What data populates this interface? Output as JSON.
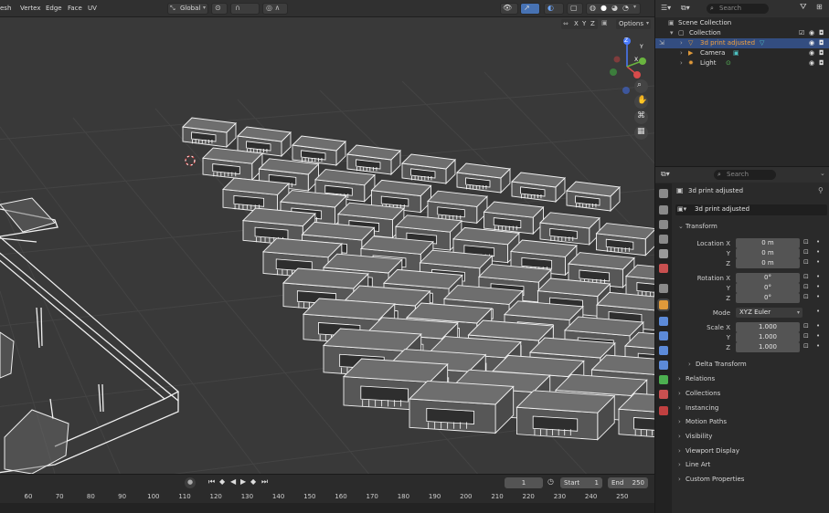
{
  "viewport_header": {
    "menus": [
      "esh",
      "Vertex",
      "Edge",
      "Face",
      "UV"
    ],
    "orientation": "Global"
  },
  "viewport_axes": {
    "x": "X",
    "y": "Y",
    "z": "Z"
  },
  "header_right": {
    "xyz": [
      "X",
      "Y",
      "Z"
    ],
    "options": "Options"
  },
  "outliner": {
    "search_placeholder": "Search",
    "items": [
      {
        "label": "Scene Collection",
        "icon": "scene-collection-icon"
      },
      {
        "label": "Collection",
        "icon": "collection-icon"
      },
      {
        "label": "3d print adjusted",
        "icon": "mesh-icon"
      },
      {
        "label": "Camera",
        "icon": "camera-icon"
      },
      {
        "label": "Light",
        "icon": "light-icon"
      }
    ]
  },
  "properties": {
    "search_placeholder": "Search",
    "object_name": "3d print adjusted",
    "data_name": "3d print adjusted",
    "transform_label": "Transform",
    "location_label": "Location X",
    "rotation_label": "Rotation X",
    "scale_label": "Scale X",
    "y_label": "Y",
    "z_label": "Z",
    "location": {
      "x": "0 m",
      "y": "0 m",
      "z": "0 m"
    },
    "rotation": {
      "x": "0°",
      "y": "0°",
      "z": "0°"
    },
    "mode_label": "Mode",
    "mode_value": "XYZ Euler",
    "scale": {
      "x": "1.000",
      "y": "1.000",
      "z": "1.000"
    },
    "sections": [
      "Delta Transform",
      "Relations",
      "Collections",
      "Instancing",
      "Motion Paths",
      "Visibility",
      "Viewport Display",
      "Line Art",
      "Custom Properties"
    ]
  },
  "timeline": {
    "current_frame": "1",
    "start_label": "Start",
    "start_value": "1",
    "end_label": "End",
    "end_value": "250",
    "ticks": [
      "60",
      "70",
      "80",
      "90",
      "100",
      "110",
      "120",
      "130",
      "140",
      "150",
      "160",
      "170",
      "180",
      "190",
      "200",
      "210",
      "220",
      "230",
      "240",
      "250"
    ]
  },
  "colors": {
    "selection": "#334d80",
    "accent_orange": "#e09a3a",
    "background_viewport": "#393939"
  }
}
